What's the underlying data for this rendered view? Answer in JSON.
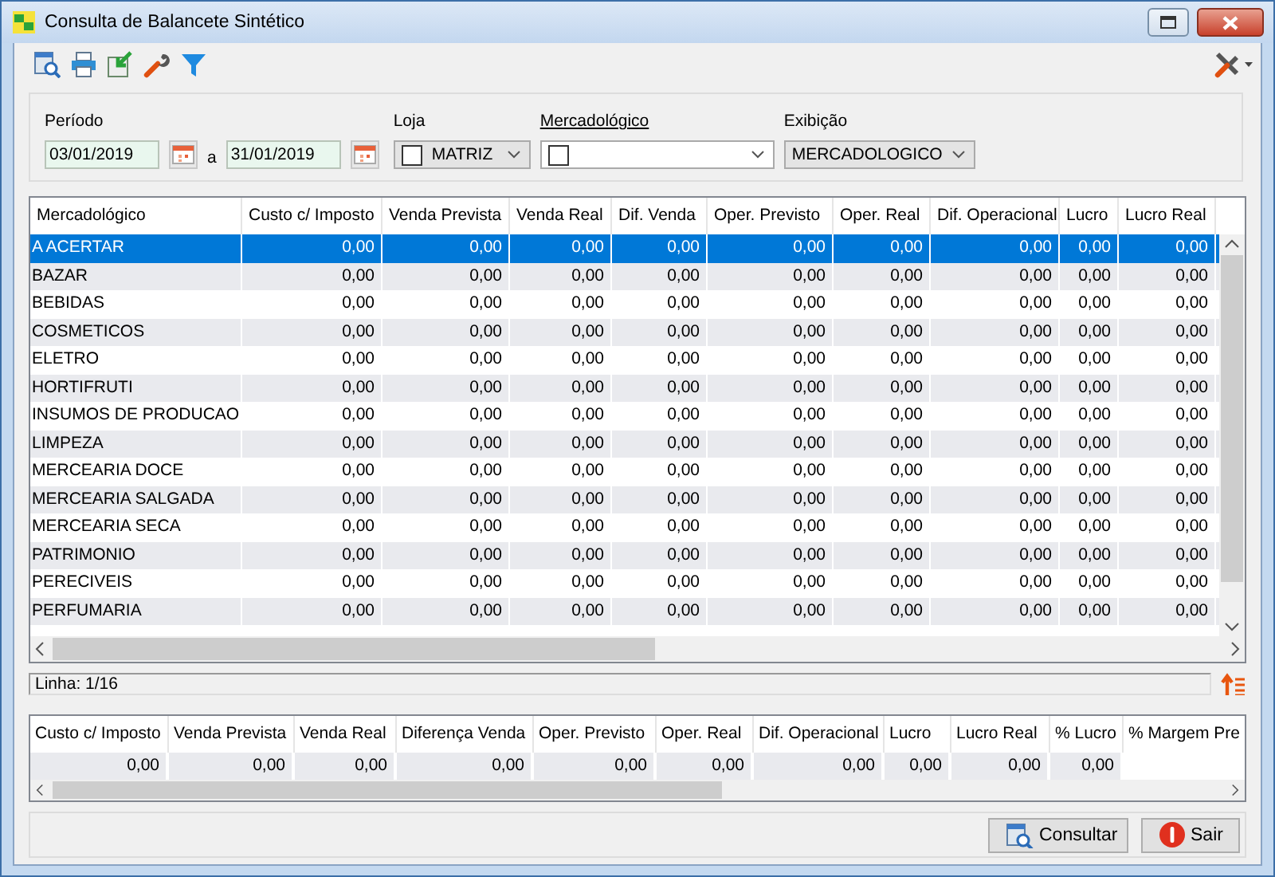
{
  "window": {
    "title": "Consulta de Balancete Sintético"
  },
  "filters": {
    "period": {
      "label": "Período",
      "start": "03/01/2019",
      "separator": "a",
      "end": "31/01/2019"
    },
    "store": {
      "label": "Loja",
      "value": "MATRIZ",
      "checked": false
    },
    "category": {
      "label": "Mercadológico",
      "checked": false
    },
    "display": {
      "label": "Exibição",
      "value": "MERCADOLOGICO"
    }
  },
  "table": {
    "columns": [
      "Mercadológico",
      "Custo c/ Imposto",
      "Venda Prevista",
      "Venda Real",
      "Dif. Venda",
      "Oper. Previsto",
      "Oper. Real",
      "Dif. Operacional",
      "Lucro",
      "Lucro Real"
    ],
    "rows": [
      {
        "label": "A ACERTAR",
        "values": [
          "0,00",
          "0,00",
          "0,00",
          "0,00",
          "0,00",
          "0,00",
          "0,00",
          "0,00",
          "0,00"
        ],
        "selected": true
      },
      {
        "label": "BAZAR",
        "values": [
          "0,00",
          "0,00",
          "0,00",
          "0,00",
          "0,00",
          "0,00",
          "0,00",
          "0,00",
          "0,00"
        ],
        "selected": false
      },
      {
        "label": "BEBIDAS",
        "values": [
          "0,00",
          "0,00",
          "0,00",
          "0,00",
          "0,00",
          "0,00",
          "0,00",
          "0,00",
          "0,00"
        ],
        "selected": false
      },
      {
        "label": "COSMETICOS",
        "values": [
          "0,00",
          "0,00",
          "0,00",
          "0,00",
          "0,00",
          "0,00",
          "0,00",
          "0,00",
          "0,00"
        ],
        "selected": false
      },
      {
        "label": "ELETRO",
        "values": [
          "0,00",
          "0,00",
          "0,00",
          "0,00",
          "0,00",
          "0,00",
          "0,00",
          "0,00",
          "0,00"
        ],
        "selected": false
      },
      {
        "label": "HORTIFRUTI",
        "values": [
          "0,00",
          "0,00",
          "0,00",
          "0,00",
          "0,00",
          "0,00",
          "0,00",
          "0,00",
          "0,00"
        ],
        "selected": false
      },
      {
        "label": "INSUMOS DE PRODUCAO",
        "values": [
          "0,00",
          "0,00",
          "0,00",
          "0,00",
          "0,00",
          "0,00",
          "0,00",
          "0,00",
          "0,00"
        ],
        "selected": false
      },
      {
        "label": "LIMPEZA",
        "values": [
          "0,00",
          "0,00",
          "0,00",
          "0,00",
          "0,00",
          "0,00",
          "0,00",
          "0,00",
          "0,00"
        ],
        "selected": false
      },
      {
        "label": "MERCEARIA DOCE",
        "values": [
          "0,00",
          "0,00",
          "0,00",
          "0,00",
          "0,00",
          "0,00",
          "0,00",
          "0,00",
          "0,00"
        ],
        "selected": false
      },
      {
        "label": "MERCEARIA SALGADA",
        "values": [
          "0,00",
          "0,00",
          "0,00",
          "0,00",
          "0,00",
          "0,00",
          "0,00",
          "0,00",
          "0,00"
        ],
        "selected": false
      },
      {
        "label": "MERCEARIA SECA",
        "values": [
          "0,00",
          "0,00",
          "0,00",
          "0,00",
          "0,00",
          "0,00",
          "0,00",
          "0,00",
          "0,00"
        ],
        "selected": false
      },
      {
        "label": "PATRIMONIO",
        "values": [
          "0,00",
          "0,00",
          "0,00",
          "0,00",
          "0,00",
          "0,00",
          "0,00",
          "0,00",
          "0,00"
        ],
        "selected": false
      },
      {
        "label": "PERECIVEIS",
        "values": [
          "0,00",
          "0,00",
          "0,00",
          "0,00",
          "0,00",
          "0,00",
          "0,00",
          "0,00",
          "0,00"
        ],
        "selected": false
      },
      {
        "label": "PERFUMARIA",
        "values": [
          "0,00",
          "0,00",
          "0,00",
          "0,00",
          "0,00",
          "0,00",
          "0,00",
          "0,00",
          "0,00"
        ],
        "selected": false
      }
    ]
  },
  "status_bar": {
    "text": "Linha: 1/16"
  },
  "totals": {
    "columns": [
      "Custo c/ Imposto",
      "Venda Prevista",
      "Venda Real",
      "Diferença Venda",
      "Oper. Previsto",
      "Oper. Real",
      "Dif. Operacional",
      "Lucro",
      "Lucro Real",
      "% Lucro",
      "% Margem Pre"
    ],
    "values": [
      "0,00",
      "0,00",
      "0,00",
      "0,00",
      "0,00",
      "0,00",
      "0,00",
      "0,00",
      "0,00",
      "0,00"
    ]
  },
  "buttons": [
    {
      "kind": "search",
      "label": "Consultar"
    },
    {
      "kind": "exit",
      "label": "Sair"
    }
  ]
}
